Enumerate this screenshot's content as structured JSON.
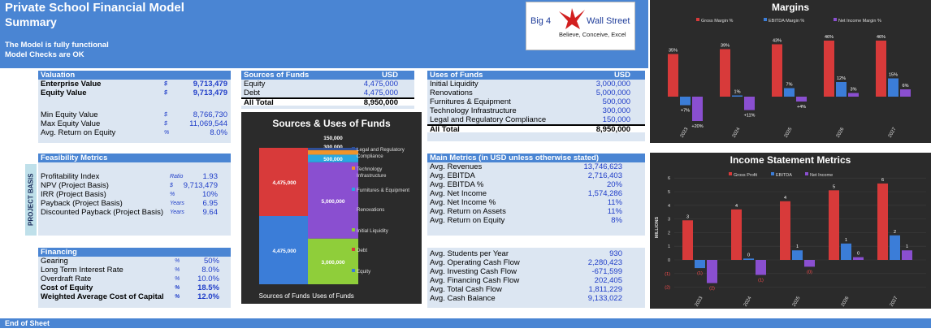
{
  "header": {
    "title": "Private School Financial Model",
    "subtitle": "Summary",
    "note1": "The Model is fully functional",
    "note2": "Model Checks are OK"
  },
  "logo": {
    "left": "Big 4",
    "right": "Wall Street",
    "tagline": "Believe, Conceive, Excel"
  },
  "valuation": {
    "title": "Valuation",
    "rows": [
      {
        "label": "Enterprise Value",
        "unit": "$",
        "value": "9,713,479",
        "bold": true
      },
      {
        "label": "Equity Value",
        "unit": "$",
        "value": "9,713,479",
        "bold": true
      },
      {
        "label": "Min Equity Value",
        "unit": "$",
        "value": "8,766,730",
        "bold": false
      },
      {
        "label": "Max Equity Value",
        "unit": "$",
        "value": "11,069,544",
        "bold": false
      },
      {
        "label": "Avg. Return on Equity",
        "unit": "%",
        "value": "8.0%",
        "bold": false
      }
    ]
  },
  "feasibility": {
    "title": "Feasibility Metrics",
    "side_label": "PROJECT BASIS",
    "rows": [
      {
        "label": "Profitability Index",
        "unit": "Ratio",
        "value": "1.93"
      },
      {
        "label": "NPV (Project Basis)",
        "unit": "$",
        "value": "9,713,479"
      },
      {
        "label": "IRR (Project Basis)",
        "unit": "%",
        "value": "10%"
      },
      {
        "label": "Payback  (Project Basis)",
        "unit": "Years",
        "value": "6.95"
      },
      {
        "label": "Discounted Payback  (Project Basis)",
        "unit": "Years",
        "value": "9.64"
      }
    ]
  },
  "financing": {
    "title": "Financing",
    "rows": [
      {
        "label": "Gearing",
        "unit": "%",
        "value": "50%",
        "bold": false
      },
      {
        "label": "Long Term Interest Rate",
        "unit": "%",
        "value": "8.0%",
        "bold": false
      },
      {
        "label": "Overdraft Rate",
        "unit": "%",
        "value": "10.0%",
        "bold": false
      },
      {
        "label": "Cost of Equity",
        "unit": "%",
        "value": "18.5%",
        "bold": true
      },
      {
        "label": "Weighted Average Cost of Capital",
        "unit": "%",
        "value": "12.0%",
        "bold": true
      }
    ]
  },
  "sources": {
    "title": "Sources of Funds",
    "currency": "USD",
    "rows": [
      {
        "label": "Equity",
        "value": "4,475,000"
      },
      {
        "label": "Debt",
        "value": "4,475,000"
      }
    ],
    "total_label": "All Total",
    "total_value": "8,950,000"
  },
  "uses": {
    "title": "Uses of Funds",
    "currency": "USD",
    "rows": [
      {
        "label": "Initial Liquidity",
        "value": "3,000,000"
      },
      {
        "label": "Renovations",
        "value": "5,000,000"
      },
      {
        "label": "Furnitures & Equipment",
        "value": "500,000"
      },
      {
        "label": "Technology Infrastructure",
        "value": "300,000"
      },
      {
        "label": "Legal and Regulatory Compliance",
        "value": "150,000"
      }
    ],
    "total_label": "All Total",
    "total_value": "8,950,000"
  },
  "main_metrics": {
    "title": "Main Metrics (in USD unless otherwise stated)",
    "rows": [
      {
        "label": "Avg. Revenues",
        "value": "13,746,623"
      },
      {
        "label": "Avg. EBITDA",
        "value": "2,716,403"
      },
      {
        "label": "Avg. EBITDA %",
        "value": "20%"
      },
      {
        "label": "Avg. Net Income",
        "value": "1,574,286"
      },
      {
        "label": "Avg. Net Income %",
        "value": "11%"
      },
      {
        "label": "Avg. Return on Assets",
        "value": "11%"
      },
      {
        "label": "Avg. Return on Equity",
        "value": "8%"
      }
    ]
  },
  "other_metrics": {
    "rows": [
      {
        "label": "Avg. Students per Year",
        "value": "930"
      },
      {
        "label": "Avg. Operating Cash Flow",
        "value": "2,280,423"
      },
      {
        "label": "Avg. Investing Cash Flow",
        "value": "-671,599"
      },
      {
        "label": "Avg. Financing Cash Flow",
        "value": "202,405"
      },
      {
        "label": "Avg. Total Cash Flow",
        "value": "1,811,229"
      },
      {
        "label": "Avg. Cash Balance",
        "value": "9,133,022"
      }
    ]
  },
  "footer": {
    "text": "End of Sheet"
  },
  "chart_data": [
    {
      "type": "bar",
      "title": "Sources & Uses of Funds",
      "categories": [
        "Sources of Funds",
        "Uses of Funds"
      ],
      "stacked": true,
      "series": [
        {
          "name": "Equity",
          "values": [
            4475000,
            0
          ],
          "labels": [
            "4,475,000",
            ""
          ],
          "color": "#3b7dd8"
        },
        {
          "name": "Debt",
          "values": [
            4475000,
            0
          ],
          "labels": [
            "4,475,000",
            ""
          ],
          "color": "#d83a3a"
        },
        {
          "name": "Initial Liquidity",
          "values": [
            0,
            3000000
          ],
          "labels": [
            "",
            "3,000,000"
          ],
          "color": "#8fce3a"
        },
        {
          "name": "Renovations",
          "values": [
            0,
            5000000
          ],
          "labels": [
            "",
            "5,000,000"
          ],
          "color": "#8a4fd0"
        },
        {
          "name": "Furnitures & Equipment",
          "values": [
            0,
            500000
          ],
          "labels": [
            "",
            "500,000"
          ],
          "color": "#2aa7e0"
        },
        {
          "name": "Technology Infrastructure",
          "values": [
            0,
            300000
          ],
          "labels": [
            "",
            "300,000"
          ],
          "color": "#f0942a"
        },
        {
          "name": "Legal and Regulatory Compliance",
          "values": [
            0,
            150000
          ],
          "labels": [
            "",
            "150,000"
          ],
          "color": "#2e4f9a"
        }
      ],
      "legend": [
        "Legal and Regulatory Compliance",
        "Technology Infrastructure",
        "Furnitures & Equipment",
        "Renovations",
        "Initial Liquidity",
        "Debt",
        "Equity"
      ],
      "legend_position": "right"
    },
    {
      "type": "bar",
      "title": "Margins",
      "categories": [
        "2023",
        "2024",
        "2025",
        "2026",
        "2027"
      ],
      "series": [
        {
          "name": "Gross Margin %",
          "values": [
            35,
            39,
            43,
            46,
            46
          ],
          "labels": [
            "35%",
            "39%",
            "43%",
            "46%",
            "46%"
          ],
          "color": "#d83a3a"
        },
        {
          "name": "EBITDA Margin %",
          "values": [
            -7,
            1,
            7,
            12,
            15
          ],
          "labels": [
            "+7%",
            "1%",
            "7%",
            "12%",
            "15%"
          ],
          "color": "#3b7dd8"
        },
        {
          "name": "Net Income Margin %",
          "values": [
            -20,
            -11,
            -4,
            3,
            6
          ],
          "labels": [
            "+20%",
            "+11%",
            "+4%",
            "3%",
            "6%"
          ],
          "color": "#8a4fd0"
        }
      ],
      "ylim": [
        -25,
        50
      ],
      "legend_position": "top",
      "grid": false
    },
    {
      "type": "bar",
      "title": "Income Statement Metrics",
      "categories": [
        "2023",
        "2024",
        "2025",
        "2026",
        "2027"
      ],
      "series": [
        {
          "name": "Gross Profit",
          "values": [
            2.9,
            3.7,
            4.3,
            5.1,
            5.6
          ],
          "labels": [
            "3",
            "4",
            "4",
            "5",
            "6"
          ],
          "color": "#d83a3a"
        },
        {
          "name": "EBITDA",
          "values": [
            -0.6,
            0.1,
            0.7,
            1.2,
            1.8
          ],
          "labels": [
            "(1)",
            "0",
            "1",
            "1",
            "2"
          ],
          "color": "#3b7dd8"
        },
        {
          "name": "Net Income",
          "values": [
            -1.7,
            -1.1,
            -0.5,
            0.2,
            0.7
          ],
          "labels": [
            "(2)",
            "(1)",
            "(0)",
            "0",
            "1"
          ],
          "color": "#8a4fd0"
        }
      ],
      "ylabel": "MILLIONS",
      "yticks": [
        "(2)",
        "(1)",
        "0",
        "1",
        "2",
        "3",
        "4",
        "5",
        "6"
      ],
      "ylim": [
        -2,
        6
      ],
      "legend_position": "top",
      "grid": true
    }
  ]
}
